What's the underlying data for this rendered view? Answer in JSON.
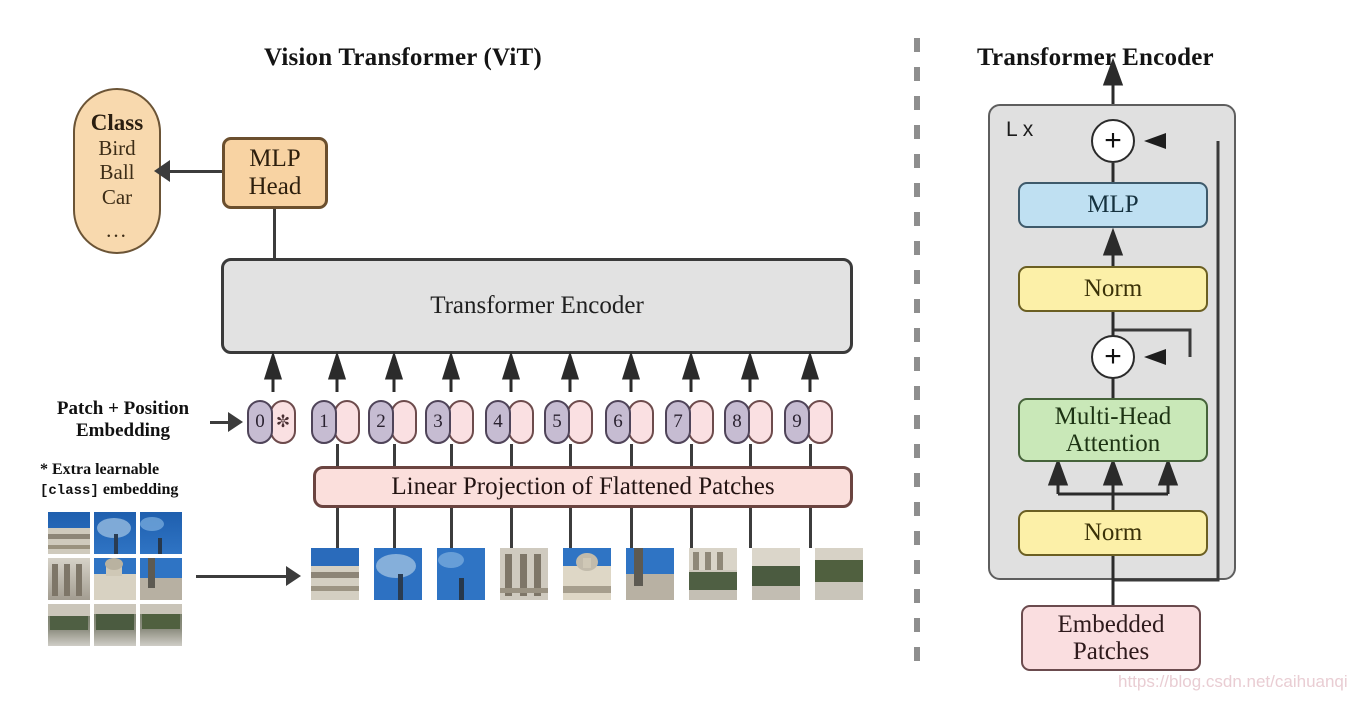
{
  "figure": {
    "left_title": "Vision Transformer (ViT)",
    "right_title": "Transformer Encoder"
  },
  "class_pill": {
    "heading": "Class",
    "items": [
      "Bird",
      "Ball",
      "Car"
    ],
    "ellipsis": "..."
  },
  "mlp_head": {
    "line1": "MLP",
    "line2": "Head"
  },
  "encoder_bar": {
    "label": "Transformer Encoder"
  },
  "linear_projection": {
    "label": "Linear Projection of Flattened Patches"
  },
  "embedding_labels": {
    "main_line1": "Patch + Position",
    "main_line2": "Embedding",
    "note_line1": "* Extra learnable",
    "note_mono": "[class]",
    "note_line2_tail": " embedding"
  },
  "tokens": [
    {
      "number": "0",
      "star": "✼"
    },
    {
      "number": "1",
      "star": ""
    },
    {
      "number": "2",
      "star": ""
    },
    {
      "number": "3",
      "star": ""
    },
    {
      "number": "4",
      "star": ""
    },
    {
      "number": "5",
      "star": ""
    },
    {
      "number": "6",
      "star": ""
    },
    {
      "number": "7",
      "star": ""
    },
    {
      "number": "8",
      "star": ""
    },
    {
      "number": "9",
      "star": ""
    }
  ],
  "encoder": {
    "repeat_label": "L x",
    "plus_symbol": "+",
    "blocks": {
      "mlp": "MLP",
      "norm_top": "Norm",
      "attention_line1": "Multi-Head",
      "attention_line2": "Attention",
      "norm_bottom": "Norm",
      "embedded_line1": "Embedded",
      "embedded_line2": "Patches"
    }
  },
  "colors": {
    "class_pill": "#f8d9ae",
    "mlp_head": "#f8d3a3",
    "encoder_bar": "#e2e2e2",
    "linear_projection": "#fbdfdc",
    "token_number": "#c6bcd2",
    "token_embedding": "#fae0e2",
    "mlp_block": "#bfe0f2",
    "norm_block": "#fcf0a8",
    "attention_block": "#c9e8b8",
    "embedded_patches": "#fadee0",
    "encoder_outer": "#e0e0e0"
  },
  "watermark": {
    "text": "https://blog.csdn.net/caihuanqia"
  }
}
